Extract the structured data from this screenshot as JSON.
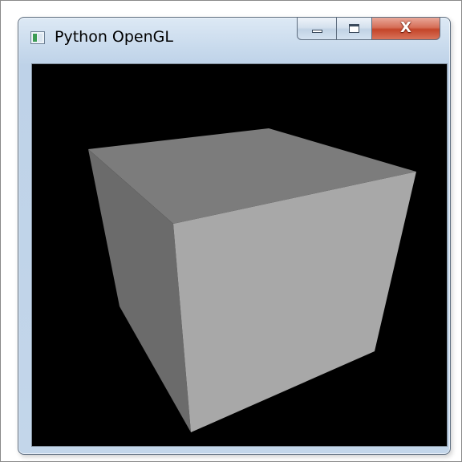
{
  "window": {
    "title": "Python OpenGL",
    "app_icon": "window-app-icon",
    "buttons": {
      "minimize_icon": "minimize-icon",
      "maximize_icon": "maximize-icon",
      "close_icon": "close-icon",
      "close_glyph": "X"
    }
  },
  "scene": {
    "background_color": "#000000",
    "object": "cube",
    "face_colors": {
      "top": "#7c7c7c",
      "left": "#6b6b6b",
      "front": "#a8a8a8"
    }
  }
}
